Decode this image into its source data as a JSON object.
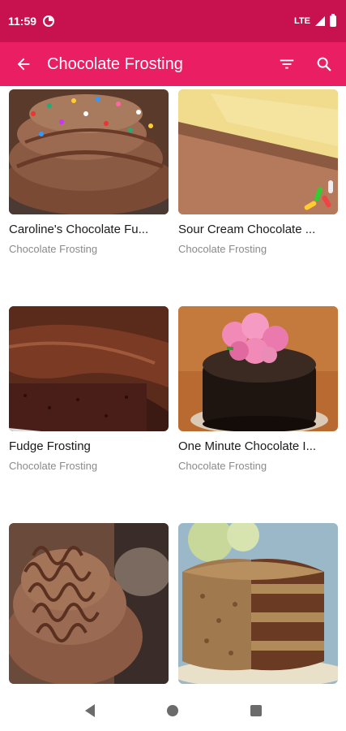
{
  "status_bar": {
    "time": "11:59",
    "network": "LTE"
  },
  "app_bar": {
    "title": "Chocolate Frosting",
    "icons": [
      "back-arrow-icon",
      "filter-icon",
      "search-icon"
    ]
  },
  "recipes": [
    {
      "name": "Caroline's Chocolate Fu...",
      "category": "Chocolate Frosting",
      "image": "chocolate frosting swirl with sprinkles"
    },
    {
      "name": "Sour Cream Chocolate ...",
      "category": "Chocolate Frosting",
      "image": "yellow layer cake with chocolate frosting"
    },
    {
      "name": "Fudge Frosting",
      "category": "Chocolate Frosting",
      "image": "chocolate glazed fudge cake"
    },
    {
      "name": "One Minute Chocolate I...",
      "category": "Chocolate Frosting",
      "image": "chocolate glazed cake with pink flowers"
    },
    {
      "name": "",
      "category": "",
      "image": "chocolate curl cupcake"
    },
    {
      "name": "",
      "category": "",
      "image": "german chocolate layer cake"
    }
  ],
  "colors": {
    "status_bar": "#c8124f",
    "app_bar": "#e91e63",
    "secondary_text": "#8a8a8a"
  }
}
